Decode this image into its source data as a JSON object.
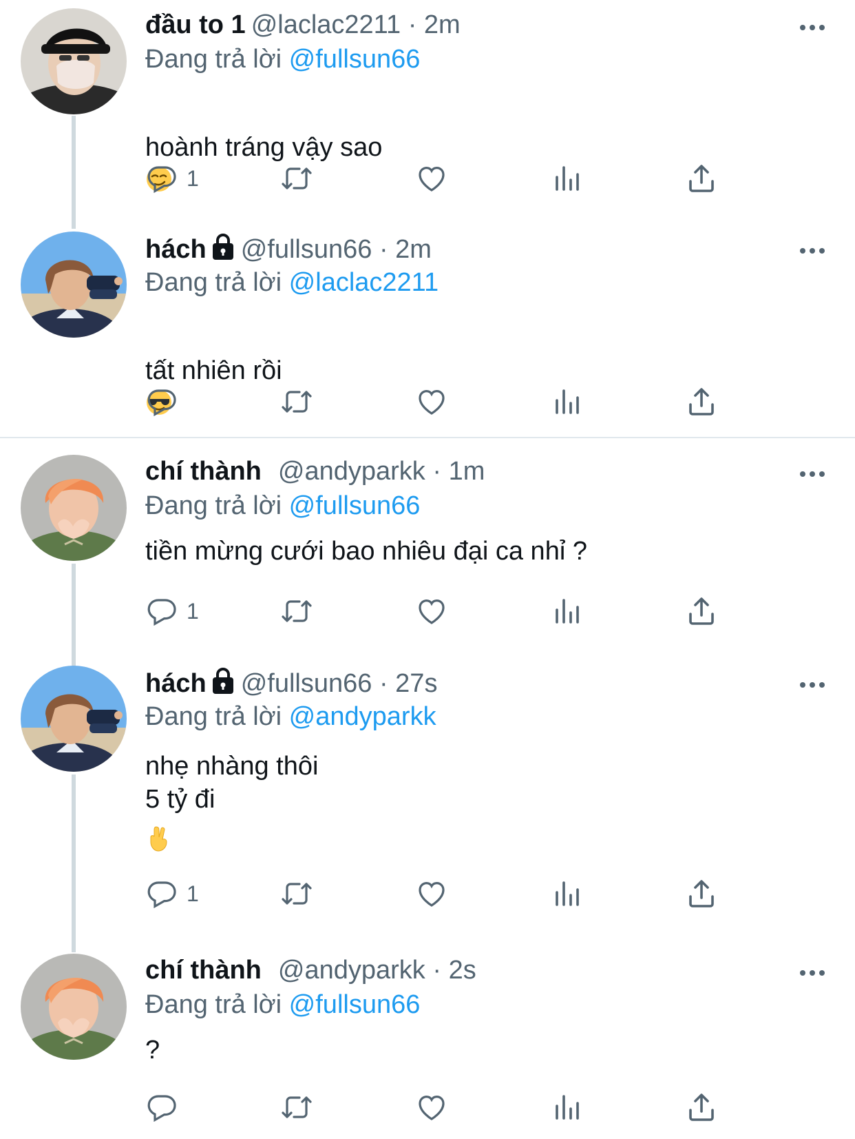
{
  "replying_label": "Đang trả lời",
  "tweets": [
    {
      "name": "đầu to 1",
      "handle": "@laclac2211",
      "sep": "·",
      "time": "2m",
      "reply_to": "@fullsun66",
      "text": "hoành tráng vậy sao",
      "emoji": "smirk-emoji",
      "reply_count": "1",
      "locked": false
    },
    {
      "name": "hách",
      "handle": "@fullsun66",
      "sep": "·",
      "time": "2m",
      "reply_to": "@laclac2211",
      "text": "tất nhiên rồi",
      "emoji": "sunglasses-emoji",
      "reply_count": "",
      "locked": true
    },
    {
      "name": "chí thành",
      "handle": "@andyparkk",
      "sep": "·",
      "time": "1m",
      "reply_to": "@fullsun66",
      "text": "tiền mừng cưới bao nhiêu đại ca nhỉ ?",
      "reply_count": "1",
      "locked": false
    },
    {
      "name": "hách",
      "handle": "@fullsun66",
      "sep": "·",
      "time": "27s",
      "reply_to": "@andyparkk",
      "text": "nhẹ nhàng thôi\n5 tỷ đi",
      "emoji": "crossed-fingers-emoji",
      "reply_count": "1",
      "locked": true
    },
    {
      "name": "chí thành",
      "handle": "@andyparkk",
      "sep": "·",
      "time": "2s",
      "reply_to": "@fullsun66",
      "text": "?",
      "reply_count": "",
      "locked": false
    }
  ],
  "colors": {
    "accent": "#1d9bf0",
    "secondary_text": "#536471",
    "thread_line": "#cfd9de"
  }
}
